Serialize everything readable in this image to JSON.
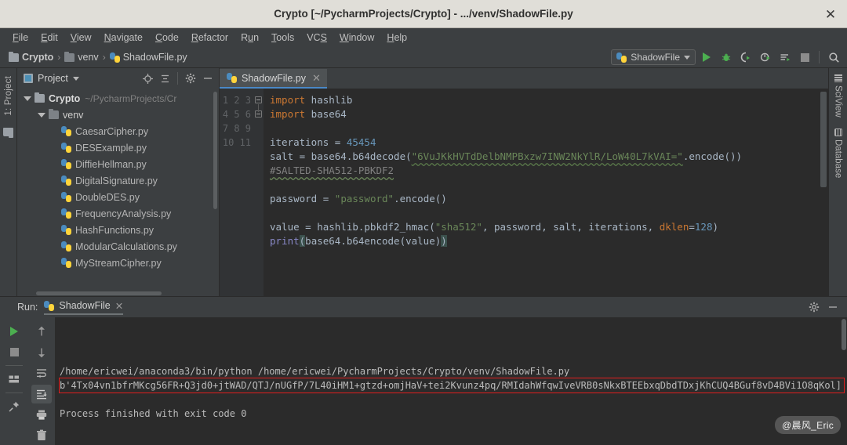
{
  "window": {
    "title": "Crypto [~/PycharmProjects/Crypto] - .../venv/ShadowFile.py",
    "close_label": "✕"
  },
  "menubar": {
    "items": [
      {
        "mnemonic": "F",
        "rest": "ile"
      },
      {
        "mnemonic": "E",
        "rest": "dit"
      },
      {
        "mnemonic": "V",
        "rest": "iew"
      },
      {
        "mnemonic": "N",
        "rest": "avigate"
      },
      {
        "mnemonic": "C",
        "rest": "ode"
      },
      {
        "mnemonic": "R",
        "rest": "efactor"
      },
      {
        "mnemonic": "R",
        "rest": "un",
        "pre": "R",
        "mid": "u",
        "post": "n"
      },
      {
        "mnemonic": "T",
        "rest": "ools"
      },
      {
        "mnemonic": "S",
        "rest": "VCS"
      },
      {
        "mnemonic": "W",
        "rest": "indow"
      },
      {
        "mnemonic": "H",
        "rest": "elp"
      }
    ],
    "labels": [
      "File",
      "Edit",
      "View",
      "Navigate",
      "Code",
      "Refactor",
      "Run",
      "Tools",
      "VCS",
      "Window",
      "Help"
    ]
  },
  "breadcrumb": {
    "project": "Crypto",
    "folder": "venv",
    "file": "ShadowFile.py",
    "separator": "›"
  },
  "toolbar": {
    "run_config": "ShadowFile",
    "buttons": [
      "run-button",
      "debug-button",
      "run-coverage-button",
      "profile-button",
      "run-with-button",
      "stop-button",
      "search-button"
    ]
  },
  "left_rail": {
    "project_tab": "1: Project"
  },
  "project_panel": {
    "title": "Project",
    "tree": [
      {
        "label": "Crypto",
        "sub": "~/PycharmProjects/Cr",
        "type": "folder-root",
        "indent": 0,
        "expanded": true
      },
      {
        "label": "venv",
        "sub": "",
        "type": "folder",
        "indent": 1,
        "expanded": true
      },
      {
        "label": "CaesarCipher.py",
        "sub": "",
        "type": "py",
        "indent": 2
      },
      {
        "label": "DESExample.py",
        "sub": "",
        "type": "py",
        "indent": 2
      },
      {
        "label": "DiffieHellman.py",
        "sub": "",
        "type": "py",
        "indent": 2
      },
      {
        "label": "DigitalSignature.py",
        "sub": "",
        "type": "py",
        "indent": 2
      },
      {
        "label": "DoubleDES.py",
        "sub": "",
        "type": "py",
        "indent": 2
      },
      {
        "label": "FrequencyAnalysis.py",
        "sub": "",
        "type": "py",
        "indent": 2
      },
      {
        "label": "HashFunctions.py",
        "sub": "",
        "type": "py",
        "indent": 2
      },
      {
        "label": "ModularCalculations.py",
        "sub": "",
        "type": "py",
        "indent": 2
      },
      {
        "label": "MyStreamCipher.py",
        "sub": "",
        "type": "py",
        "indent": 2
      }
    ]
  },
  "editor": {
    "tab_label": "ShadowFile.py",
    "tab_close": "✕",
    "line_numbers": [
      "1",
      "2",
      "3",
      "4",
      "5",
      "6",
      "7",
      "8",
      "9",
      "10",
      "11"
    ],
    "code": {
      "l1_kw": "import",
      "l1_mod": " hashlib",
      "l2_kw": "import",
      "l2_mod": " base64",
      "l4_var": "iterations = ",
      "l4_num": "45454",
      "l5_a": "salt = base64.b64decode(",
      "l5_str": "\"6VuJKkHVTdDelbNMPBxzw7INW2NkYlR/LoW40L7kVAI=\"",
      "l5_b": ".encode())",
      "l6_cmt": "#SALTED-SHA512-PBKDF2",
      "l8_a": "password = ",
      "l8_str": "\"password\"",
      "l8_b": ".encode()",
      "l10_a": "value = hashlib.pbkdf2_hmac(",
      "l10_str": "\"sha512\"",
      "l10_b": ", password, salt, iterations, ",
      "l10_param": "dklen",
      "l10_eq": "=",
      "l10_num": "128",
      "l10_c": ")",
      "l11_fn": "print",
      "l11_open": "(",
      "l11_body": "base64.b64encode(value)",
      "l11_close": ")"
    }
  },
  "right_rail": {
    "sciview": "SciView",
    "database": "Database"
  },
  "run_panel": {
    "label": "Run:",
    "tab": "ShadowFile",
    "tab_close": "✕",
    "console": {
      "command": "/home/ericwei/anaconda3/bin/python /home/ericwei/PycharmProjects/Crypto/venv/ShadowFile.py",
      "output": "b'4Tx04vn1bfrMKcg56FR+Q3jd0+jtWAD/QTJ/nUGfP/7L40iHM1+gtzd+omjHaV+tei2Kvunz4pq/RMIdahWfqwIveVRB0sNkxBTEEbxqDbdTDxjKhCUQ4BGuf8vD4BVi1O8qKol]",
      "status": "Process finished with exit code 0"
    },
    "tool_buttons": [
      "rerun-button",
      "stop-button",
      "layout-button",
      "pin-button",
      "up-arrow-button",
      "down-arrow-button",
      "soft-wrap-button",
      "scroll-to-end-button",
      "print-button",
      "clear-all-button"
    ]
  },
  "watermark": "@晨风_Eric",
  "colors": {
    "accent_blue": "#4a88c7",
    "run_green": "#4caf50",
    "error_red": "#e01e1e",
    "string_green": "#6a8759",
    "keyword_orange": "#cc7832",
    "number_blue": "#6897bb"
  }
}
